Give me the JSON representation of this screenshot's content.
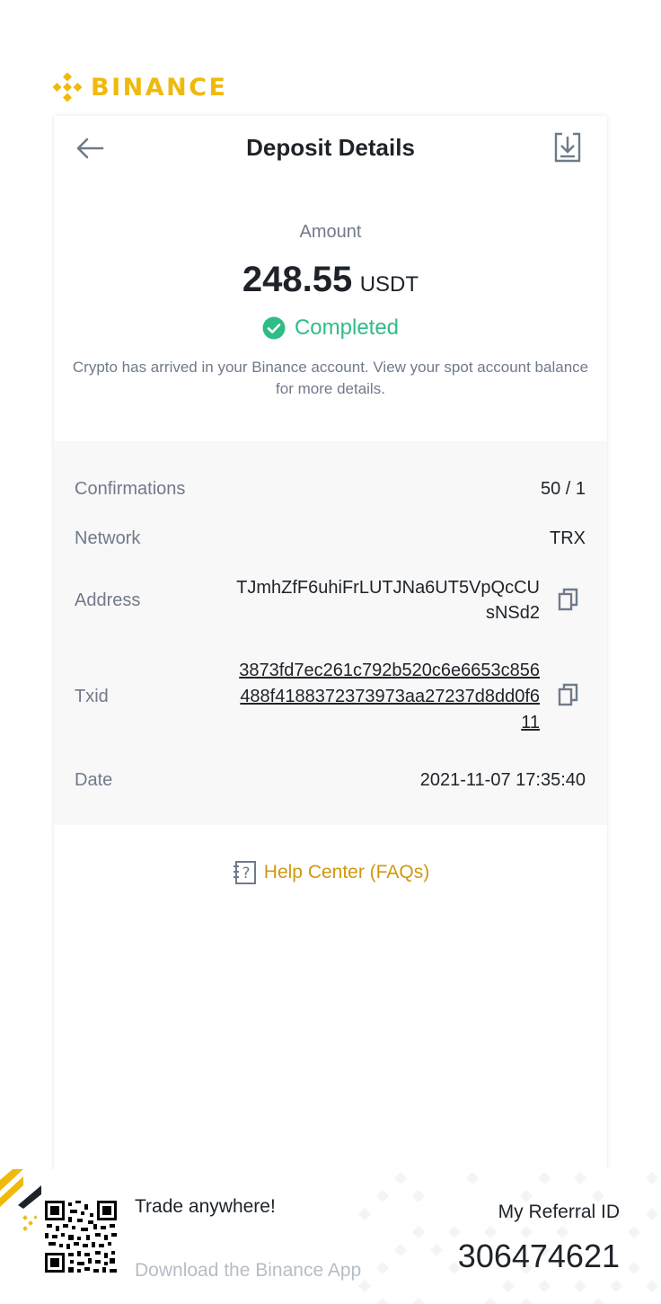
{
  "brand": {
    "name": "BINANCE",
    "logo_icon": "binance-logo-icon",
    "color": "#f0b90b"
  },
  "header": {
    "title": "Deposit Details",
    "back_icon": "arrow-left-icon",
    "download_icon": "download-icon"
  },
  "summary": {
    "amount_label": "Amount",
    "amount": "248.55",
    "unit": "USDT",
    "status": "Completed",
    "status_icon": "check-circle-icon",
    "status_color": "#2ebd85",
    "description": "Crypto has arrived in your Binance account. View your spot account balance for more details."
  },
  "details": {
    "confirmations": {
      "label": "Confirmations",
      "value": "50 / 1"
    },
    "network": {
      "label": "Network",
      "value": "TRX"
    },
    "address": {
      "label": "Address",
      "value": "TJmhZfF6uhiFrLUTJNa6UT5VpQcCUsNSd2",
      "copy_icon": "copy-icon"
    },
    "txid": {
      "label": "Txid",
      "value": "3873fd7ec261c792b520c6e6653c856488f4188372373973aa27237d8dd0f611",
      "copy_icon": "copy-icon"
    },
    "date": {
      "label": "Date",
      "value": "2021-11-07 17:35:40"
    }
  },
  "help": {
    "label": "Help Center (FAQs)",
    "icon": "help-question-icon",
    "color": "#d0980b"
  },
  "footer": {
    "trade": "Trade anywhere!",
    "download": "Download the Binance App",
    "referral_label": "My Referral ID",
    "referral_id": "306474621",
    "qr_icon": "qr-code-icon"
  }
}
